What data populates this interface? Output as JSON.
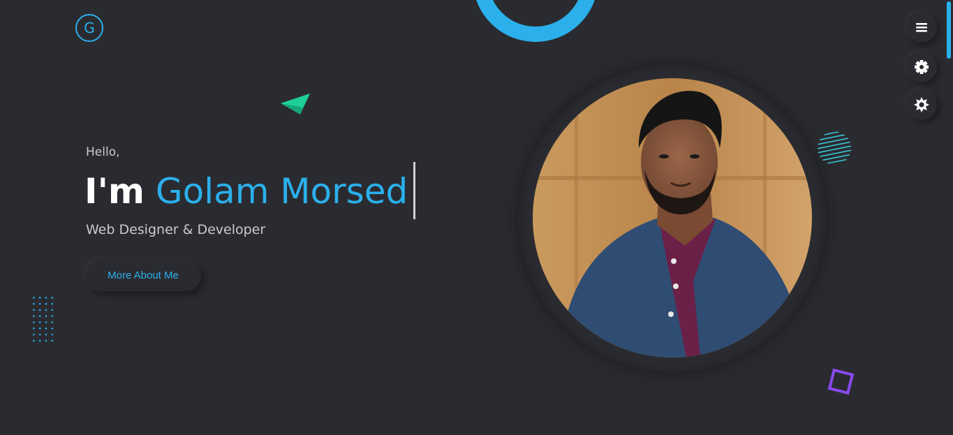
{
  "logo": {
    "letter": "G"
  },
  "hero": {
    "greeting": "Hello,",
    "prefix": "I'm",
    "name": "Golam Morsed",
    "role": "Web Designer & Developer",
    "cta_label": "More About Me"
  },
  "side_buttons": [
    {
      "icon": "menu-icon"
    },
    {
      "icon": "settings-gear-icon"
    },
    {
      "icon": "theme-toggle-icon"
    }
  ],
  "colors": {
    "background": "#2a2b30",
    "accent": "#2bb0ec",
    "triangle": "#1fcf9a",
    "square": "#8a4af2",
    "text_light": "#c9cbd1"
  },
  "portrait": {
    "alt": "Portrait photo"
  }
}
